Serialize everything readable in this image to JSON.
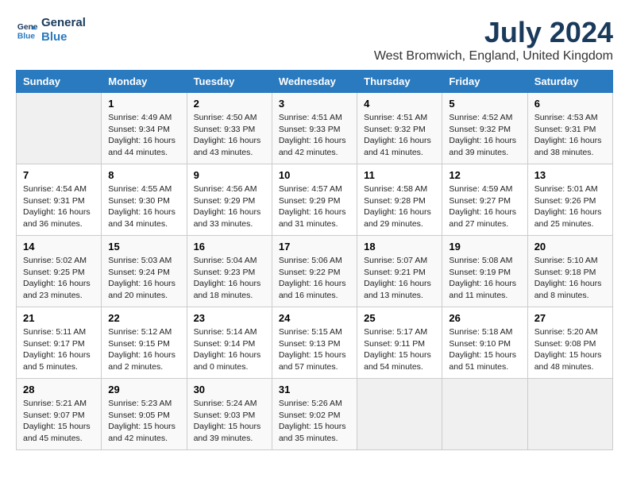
{
  "logo": {
    "line1": "General",
    "line2": "Blue"
  },
  "title": "July 2024",
  "location": "West Bromwich, England, United Kingdom",
  "days_of_week": [
    "Sunday",
    "Monday",
    "Tuesday",
    "Wednesday",
    "Thursday",
    "Friday",
    "Saturday"
  ],
  "weeks": [
    [
      {
        "day": "",
        "info": ""
      },
      {
        "day": "1",
        "info": "Sunrise: 4:49 AM\nSunset: 9:34 PM\nDaylight: 16 hours\nand 44 minutes."
      },
      {
        "day": "2",
        "info": "Sunrise: 4:50 AM\nSunset: 9:33 PM\nDaylight: 16 hours\nand 43 minutes."
      },
      {
        "day": "3",
        "info": "Sunrise: 4:51 AM\nSunset: 9:33 PM\nDaylight: 16 hours\nand 42 minutes."
      },
      {
        "day": "4",
        "info": "Sunrise: 4:51 AM\nSunset: 9:32 PM\nDaylight: 16 hours\nand 41 minutes."
      },
      {
        "day": "5",
        "info": "Sunrise: 4:52 AM\nSunset: 9:32 PM\nDaylight: 16 hours\nand 39 minutes."
      },
      {
        "day": "6",
        "info": "Sunrise: 4:53 AM\nSunset: 9:31 PM\nDaylight: 16 hours\nand 38 minutes."
      }
    ],
    [
      {
        "day": "7",
        "info": "Sunrise: 4:54 AM\nSunset: 9:31 PM\nDaylight: 16 hours\nand 36 minutes."
      },
      {
        "day": "8",
        "info": "Sunrise: 4:55 AM\nSunset: 9:30 PM\nDaylight: 16 hours\nand 34 minutes."
      },
      {
        "day": "9",
        "info": "Sunrise: 4:56 AM\nSunset: 9:29 PM\nDaylight: 16 hours\nand 33 minutes."
      },
      {
        "day": "10",
        "info": "Sunrise: 4:57 AM\nSunset: 9:29 PM\nDaylight: 16 hours\nand 31 minutes."
      },
      {
        "day": "11",
        "info": "Sunrise: 4:58 AM\nSunset: 9:28 PM\nDaylight: 16 hours\nand 29 minutes."
      },
      {
        "day": "12",
        "info": "Sunrise: 4:59 AM\nSunset: 9:27 PM\nDaylight: 16 hours\nand 27 minutes."
      },
      {
        "day": "13",
        "info": "Sunrise: 5:01 AM\nSunset: 9:26 PM\nDaylight: 16 hours\nand 25 minutes."
      }
    ],
    [
      {
        "day": "14",
        "info": "Sunrise: 5:02 AM\nSunset: 9:25 PM\nDaylight: 16 hours\nand 23 minutes."
      },
      {
        "day": "15",
        "info": "Sunrise: 5:03 AM\nSunset: 9:24 PM\nDaylight: 16 hours\nand 20 minutes."
      },
      {
        "day": "16",
        "info": "Sunrise: 5:04 AM\nSunset: 9:23 PM\nDaylight: 16 hours\nand 18 minutes."
      },
      {
        "day": "17",
        "info": "Sunrise: 5:06 AM\nSunset: 9:22 PM\nDaylight: 16 hours\nand 16 minutes."
      },
      {
        "day": "18",
        "info": "Sunrise: 5:07 AM\nSunset: 9:21 PM\nDaylight: 16 hours\nand 13 minutes."
      },
      {
        "day": "19",
        "info": "Sunrise: 5:08 AM\nSunset: 9:19 PM\nDaylight: 16 hours\nand 11 minutes."
      },
      {
        "day": "20",
        "info": "Sunrise: 5:10 AM\nSunset: 9:18 PM\nDaylight: 16 hours\nand 8 minutes."
      }
    ],
    [
      {
        "day": "21",
        "info": "Sunrise: 5:11 AM\nSunset: 9:17 PM\nDaylight: 16 hours\nand 5 minutes."
      },
      {
        "day": "22",
        "info": "Sunrise: 5:12 AM\nSunset: 9:15 PM\nDaylight: 16 hours\nand 2 minutes."
      },
      {
        "day": "23",
        "info": "Sunrise: 5:14 AM\nSunset: 9:14 PM\nDaylight: 16 hours\nand 0 minutes."
      },
      {
        "day": "24",
        "info": "Sunrise: 5:15 AM\nSunset: 9:13 PM\nDaylight: 15 hours\nand 57 minutes."
      },
      {
        "day": "25",
        "info": "Sunrise: 5:17 AM\nSunset: 9:11 PM\nDaylight: 15 hours\nand 54 minutes."
      },
      {
        "day": "26",
        "info": "Sunrise: 5:18 AM\nSunset: 9:10 PM\nDaylight: 15 hours\nand 51 minutes."
      },
      {
        "day": "27",
        "info": "Sunrise: 5:20 AM\nSunset: 9:08 PM\nDaylight: 15 hours\nand 48 minutes."
      }
    ],
    [
      {
        "day": "28",
        "info": "Sunrise: 5:21 AM\nSunset: 9:07 PM\nDaylight: 15 hours\nand 45 minutes."
      },
      {
        "day": "29",
        "info": "Sunrise: 5:23 AM\nSunset: 9:05 PM\nDaylight: 15 hours\nand 42 minutes."
      },
      {
        "day": "30",
        "info": "Sunrise: 5:24 AM\nSunset: 9:03 PM\nDaylight: 15 hours\nand 39 minutes."
      },
      {
        "day": "31",
        "info": "Sunrise: 5:26 AM\nSunset: 9:02 PM\nDaylight: 15 hours\nand 35 minutes."
      },
      {
        "day": "",
        "info": ""
      },
      {
        "day": "",
        "info": ""
      },
      {
        "day": "",
        "info": ""
      }
    ]
  ]
}
